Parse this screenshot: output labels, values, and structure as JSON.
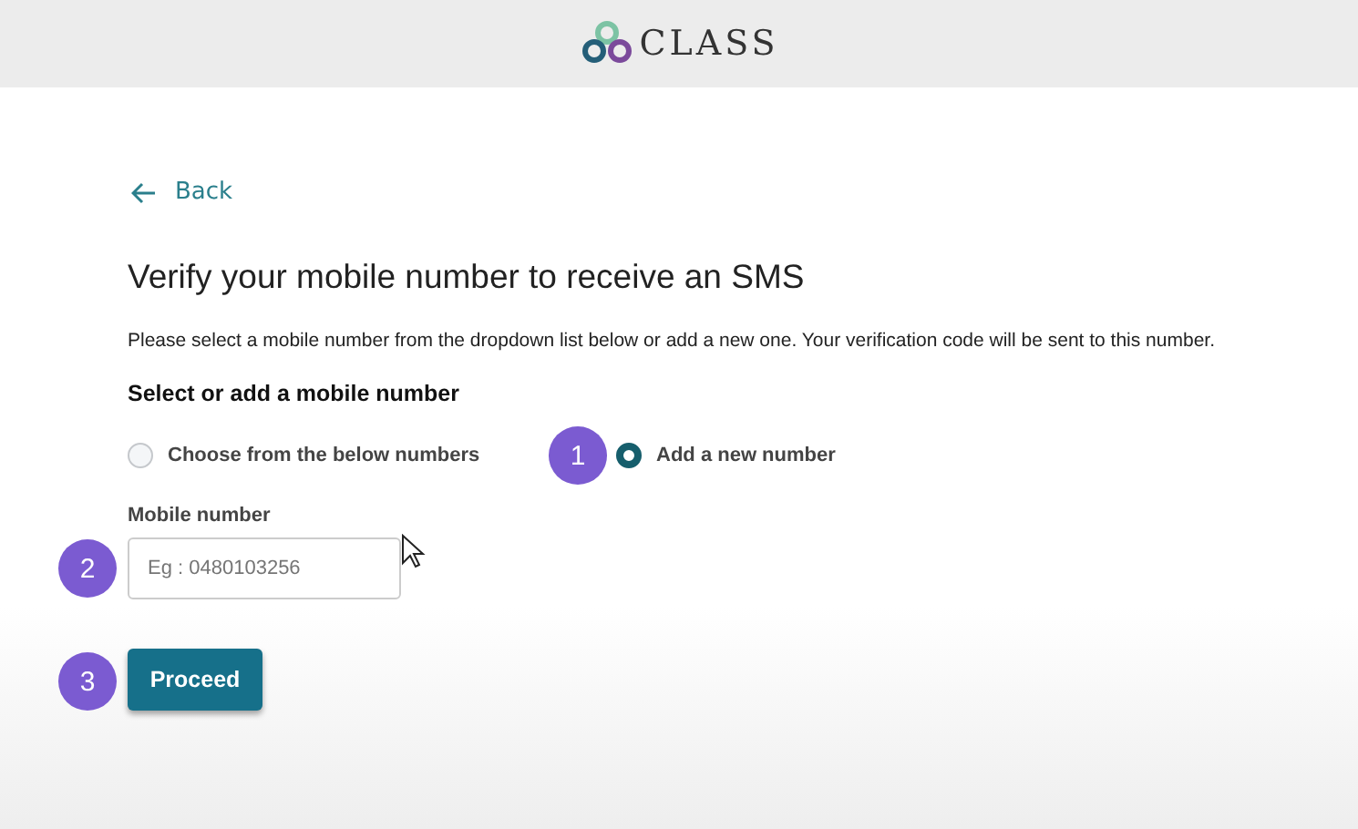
{
  "header": {
    "logo_text": "CLASS"
  },
  "back_link": {
    "label": "Back"
  },
  "title": "Verify your mobile number to receive an SMS",
  "description": "Please select a mobile number from the dropdown list below or add a new one. Your verification code will be sent to this number.",
  "section_heading": "Select or add a mobile number",
  "options": [
    {
      "label": "Choose from the below numbers",
      "selected": false
    },
    {
      "label": "Add a new number",
      "selected": true
    }
  ],
  "mobile_field": {
    "label": "Mobile number",
    "placeholder": "Eg : 0480103256"
  },
  "proceed_button": {
    "label": "Proceed"
  },
  "step_badges": [
    "1",
    "2",
    "3"
  ]
}
